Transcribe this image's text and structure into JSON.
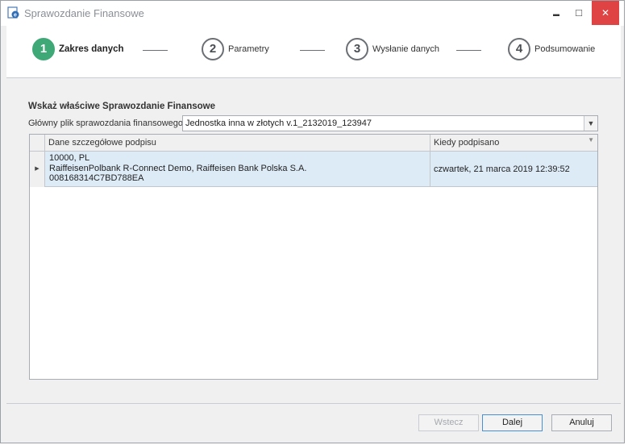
{
  "window": {
    "title": "Sprawozdanie Finansowe",
    "controls": {
      "minimize": "▬",
      "maximize": "□",
      "close": "✕"
    }
  },
  "wizard": {
    "steps": [
      {
        "number": "1",
        "label": "Zakres danych",
        "active": true
      },
      {
        "number": "2",
        "label": "Parametry",
        "active": false
      },
      {
        "number": "3",
        "label": "Wysłanie danych",
        "active": false
      },
      {
        "number": "4",
        "label": "Podsumowanie",
        "active": false
      }
    ],
    "accent_color": "#3ea877"
  },
  "form": {
    "section_title": "Wskaż właściwe Sprawozdanie Finansowe",
    "file_label": "Główny plik sprawozdania finansowego",
    "file_value": "Jednostka inna w złotych v.1_2132019_123947"
  },
  "grid": {
    "columns": [
      "Dane szczegółowe podpisu",
      "Kiedy podpisano"
    ],
    "rows": [
      {
        "details": [
          "10000, PL",
          "RaiffeisenPolbank R-Connect Demo, Raiffeisen Bank Polska S.A.",
          "008168314C7BD788EA"
        ],
        "signed": "czwartek, 21 marca 2019 12:39:52"
      }
    ]
  },
  "footer": {
    "back_label": "Wstecz",
    "next_label": "Dalej",
    "cancel_label": "Anuluj"
  }
}
